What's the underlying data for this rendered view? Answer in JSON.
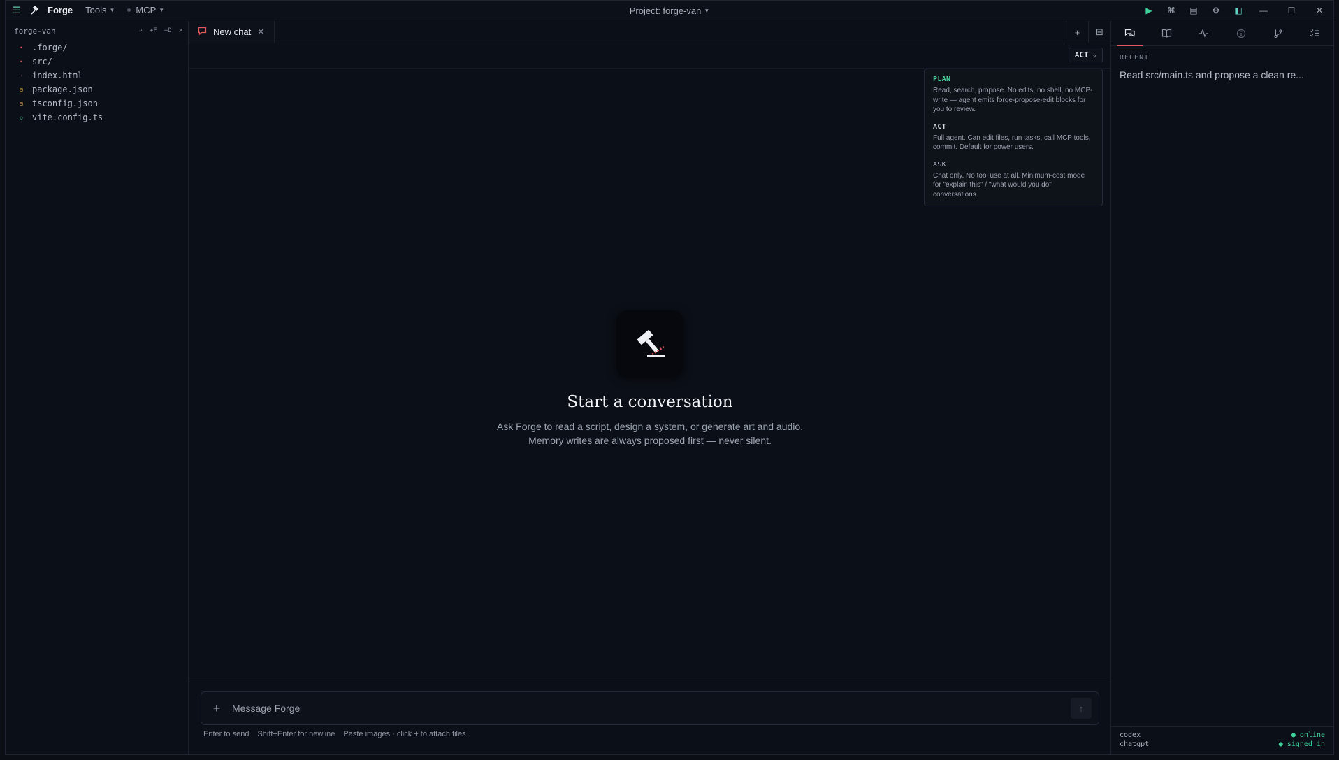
{
  "app": {
    "name": "Forge",
    "menus": [
      "Tools",
      "MCP"
    ],
    "project_label": "Project: forge-van"
  },
  "sidebar": {
    "project": "forge-van",
    "actions": [
      "⌕",
      "+F",
      "+D",
      "↗"
    ],
    "files": [
      {
        "name": ".forge/",
        "type": "folder"
      },
      {
        "name": "src/",
        "type": "folder"
      },
      {
        "name": "index.html",
        "type": "html"
      },
      {
        "name": "package.json",
        "type": "json"
      },
      {
        "name": "tsconfig.json",
        "type": "json"
      },
      {
        "name": "vite.config.ts",
        "type": "ts"
      }
    ]
  },
  "tabs": [
    {
      "label": "New chat"
    }
  ],
  "mode": {
    "current": "ACT",
    "options": [
      {
        "name": "PLAN",
        "desc": "Read, search, propose. No edits, no shell, no MCP-write — agent emits forge-propose-edit blocks for you to review."
      },
      {
        "name": "ACT",
        "desc": "Full agent. Can edit files, run tasks, call MCP tools, commit. Default for power users."
      },
      {
        "name": "ASK",
        "desc": "Chat only. No tool use at all. Minimum-cost mode for \"explain this\" / \"what would you do\" conversations."
      }
    ]
  },
  "empty_state": {
    "title": "Start a conversation",
    "desc": "Ask Forge to read a script, design a system, or generate art and audio. Memory writes are always proposed first — never silent."
  },
  "composer": {
    "placeholder": "Message Forge",
    "hints": [
      "Enter to send",
      "Shift+Enter for newline",
      "Paste images · click + to attach files"
    ]
  },
  "right_panel": {
    "recent_label": "RECENT",
    "recent_items": [
      "Read src/main.ts and propose a clean re..."
    ],
    "status": [
      {
        "name": "codex",
        "state": "● online"
      },
      {
        "name": "chatgpt",
        "state": "● signed in"
      }
    ]
  },
  "colors": {
    "accent": "#e2565d",
    "success": "#41cf9b"
  }
}
